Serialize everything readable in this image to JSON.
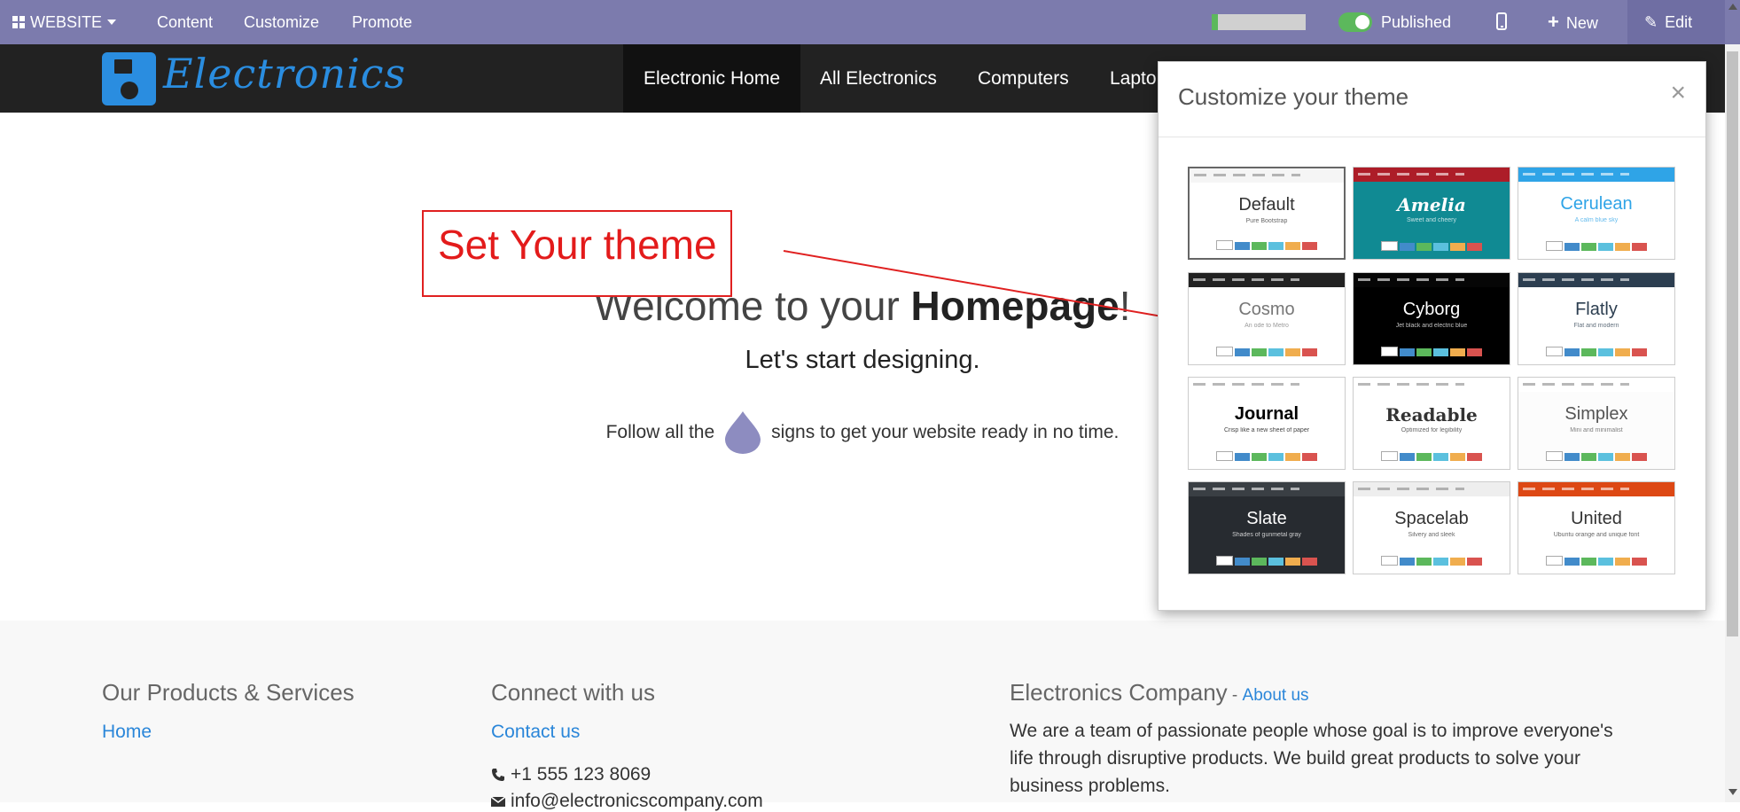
{
  "adminbar": {
    "website_label": "WEBSITE",
    "menu": [
      "Content",
      "Customize",
      "Promote"
    ],
    "progress_fraction": 0.07,
    "published_label": "Published",
    "new_label": "New",
    "edit_label": "Edit"
  },
  "navbar": {
    "logo_text": "Electronics",
    "items": [
      "Electronic Home",
      "All Electronics",
      "Computers",
      "Lapto"
    ]
  },
  "hero": {
    "title_prefix": "Welcome to your ",
    "title_bold": "Homepage",
    "title_suffix": "!",
    "subtitle": "Let's start designing.",
    "follow_prefix": "Follow all the",
    "follow_suffix": "signs to get your website ready in no time."
  },
  "annotation": {
    "text": "Set Your theme",
    "color": "#e31b1b"
  },
  "theme_modal": {
    "title": "Customize your theme",
    "close_symbol": "×",
    "themes": [
      {
        "name": "Default",
        "subtitle": "Pure Bootstrap",
        "bar": "#f5f5f5",
        "bg": "#ffffff",
        "fg": "#333333",
        "font": "sans"
      },
      {
        "name": "Amelia",
        "subtitle": "Sweet and cheery",
        "bar": "#ad1d28",
        "bg": "#108a93",
        "fg": "#ffffff",
        "font": "serif-italic"
      },
      {
        "name": "Cerulean",
        "subtitle": "A calm blue sky",
        "bar": "#2fa4e7",
        "bg": "#ffffff",
        "fg": "#2fa4e7",
        "font": "sans"
      },
      {
        "name": "Cosmo",
        "subtitle": "An ode to Metro",
        "bar": "#222222",
        "bg": "#ffffff",
        "fg": "#777777",
        "font": "light"
      },
      {
        "name": "Cyborg",
        "subtitle": "Jet black and electric blue",
        "bar": "#060606",
        "bg": "#000000",
        "fg": "#ffffff",
        "font": "sans"
      },
      {
        "name": "Flatly",
        "subtitle": "Flat and modern",
        "bar": "#2c3e50",
        "bg": "#ffffff",
        "fg": "#2c3e50",
        "font": "sans"
      },
      {
        "name": "Journal",
        "subtitle": "Crisp like a new sheet of paper",
        "bar": "#ffffff",
        "bg": "#ffffff",
        "fg": "#000000",
        "font": "bold"
      },
      {
        "name": "Readable",
        "subtitle": "Optimized for legibility",
        "bar": "#ffffff",
        "bg": "#ffffff",
        "fg": "#333333",
        "font": "serif-bold"
      },
      {
        "name": "Simplex",
        "subtitle": "Mini and minimalist",
        "bar": "#ffffff",
        "bg": "#fcfcfc",
        "fg": "#555555",
        "font": "sans"
      },
      {
        "name": "Slate",
        "subtitle": "Shades of gunmetal gray",
        "bar": "#3a3f44",
        "bg": "#272b30",
        "fg": "#ffffff",
        "font": "sans"
      },
      {
        "name": "Spacelab",
        "subtitle": "Silvery and sleek",
        "bar": "#eeeeee",
        "bg": "#ffffff",
        "fg": "#333333",
        "font": "sans"
      },
      {
        "name": "United",
        "subtitle": "Ubuntu orange and unique font",
        "bar": "#dd4814",
        "bg": "#ffffff",
        "fg": "#333333",
        "font": "sans"
      }
    ],
    "button_colors": [
      "#ffffff",
      "#428bca",
      "#5cb85c",
      "#5bc0de",
      "#f0ad4e",
      "#d9534f"
    ]
  },
  "footer": {
    "col1_title": "Our Products & Services",
    "col1_link": "Home",
    "col2_title": "Connect with us",
    "col2_link": "Contact us",
    "phone": "+1 555 123 8069",
    "email": "info@electronicscompany.com",
    "col3_title": "Electronics Company",
    "col3_sep": " - ",
    "col3_link": "About us",
    "about_text": "We are a team of passionate people whose goal is to improve everyone's life through disruptive products. We build great products to solve your business problems."
  },
  "colors": {
    "admin_bar": "#7c7bad",
    "navbar": "#222222",
    "brand_blue": "#2a8de0",
    "link": "#2a86d9",
    "drop_icon": "#8d8cc0"
  }
}
